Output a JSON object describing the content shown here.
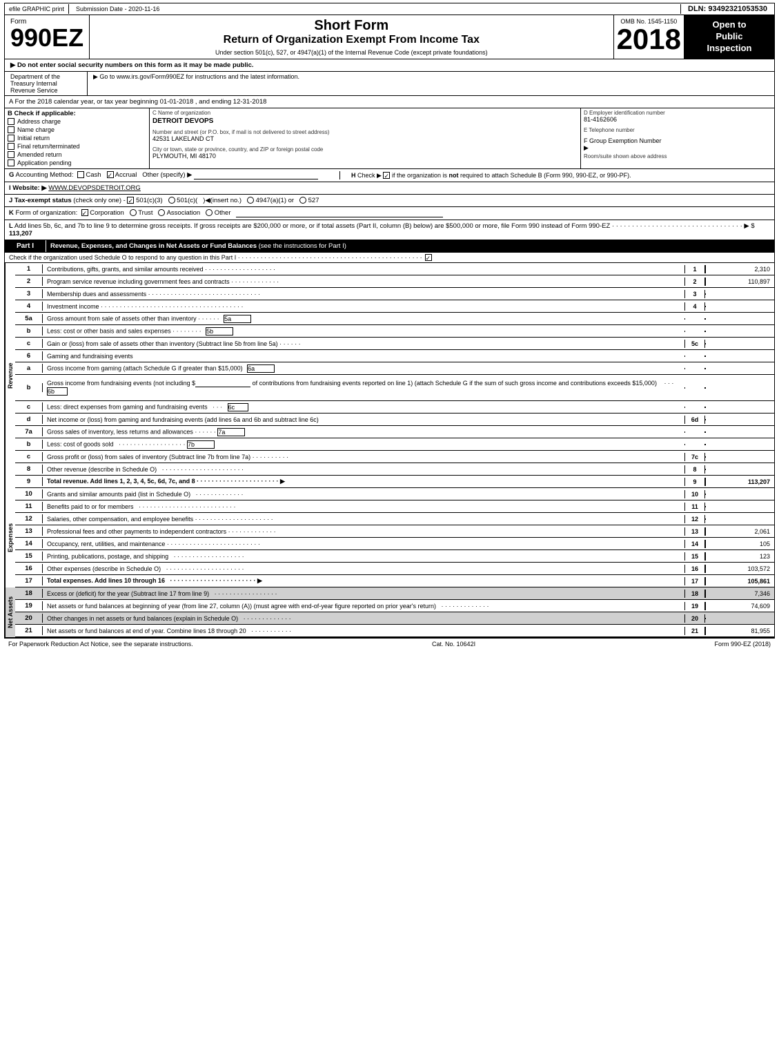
{
  "header": {
    "efile_label": "efile GRAPHIC print",
    "submission_label": "Submission Date - 2020-11-16",
    "dln": "DLN: 93492321053530",
    "form_word": "Form",
    "form_number": "990EZ",
    "short_form": "Short Form",
    "return_title": "Return of Organization Exempt From Income Tax",
    "subtitle": "Under section 501(c), 527, or 4947(a)(1) of the Internal Revenue Code (except private foundations)",
    "year": "2018",
    "omb": "OMB No. 1545-1150",
    "open_to_public": "Open to\nPublic\nInspection",
    "notice1": "▶ Do not enter social security numbers on this form as it may be made public.",
    "notice2": "▶ Go to www.irs.gov/Form990EZ for instructions and the latest information."
  },
  "dept": {
    "name": "Department of the Treasury Internal Revenue Service"
  },
  "section_a": {
    "text": "A For the 2018 calendar year, or tax year beginning 01-01-2018 , and ending 12-31-2018"
  },
  "section_b": {
    "label": "B",
    "check_label": "Check if applicable:",
    "checks": [
      {
        "label": "Address change",
        "checked": false
      },
      {
        "label": "Name change",
        "checked": false
      },
      {
        "label": "Initial return",
        "checked": false
      },
      {
        "label": "Final return/terminated",
        "checked": false
      },
      {
        "label": "Amended return",
        "checked": false
      },
      {
        "label": "Application pending",
        "checked": false
      }
    ],
    "c_label": "C Name of organization",
    "org_name": "DETROIT DEVOPS",
    "d_label": "D Employer identification number",
    "ein": "81-4162606",
    "address_label": "Number and street (or P.O. box, if mail is not delivered to street address)",
    "address": "42531 LAKELAND CT",
    "room_label": "Room/suite",
    "room": "",
    "phone_label": "E Telephone number",
    "phone": "",
    "city_label": "City or town, state or province, country, and ZIP or foreign postal code",
    "city": "PLYMOUTH, MI 48170",
    "group_label": "F Group Exemption Number",
    "group": "▶"
  },
  "section_g": {
    "label": "G Accounting Method:",
    "cash": "Cash",
    "accrual": "Accrual",
    "other": "Other (specify) ▶",
    "accrual_checked": true
  },
  "section_h": {
    "label": "H Check ▶",
    "check_label": "☑ if the organization is not required to attach Schedule B (Form 990, 990-EZ, or 990-PF)."
  },
  "section_i": {
    "label": "I Website: ▶",
    "url": "WWW.DEVOPSDETROIT.ORG"
  },
  "section_j": {
    "label": "J Tax-exempt status",
    "text": "(check only one) - ☑ 501(c)(3)  ○ 501(c)(   )◀(insert no.)  ○ 4947(a)(1) or  ○ 527"
  },
  "section_k": {
    "label": "K Form of organization:",
    "corporation": "☑ Corporation",
    "trust": "○ Trust",
    "association": "○ Association",
    "other": "○ Other"
  },
  "section_l": {
    "text": "L Add lines 5b, 6c, and 7b to line 9 to determine gross receipts. If gross receipts are $200,000 or more, or if total assets (Part II, column (B) below) are $500,000 or more, file Form 990 instead of Form 990-EZ",
    "dots": "· · · · · · · · · · · · · · · · · · · · · · · · · · · · · · · · ·",
    "arrow": "▶$",
    "value": "113,207"
  },
  "part1": {
    "label": "Part I",
    "title": "Revenue, Expenses, and Changes in Net Assets or Fund Balances",
    "title_note": "(see the instructions for Part I)",
    "check_schedule": "Check if the organization used Schedule O to respond to any question in this Part I",
    "rows": [
      {
        "num": "1",
        "desc": "Contributions, gifts, grants, and similar amounts received · · · · · · · · · · · · · · · · · · ·",
        "line": "1",
        "value": "2,310"
      },
      {
        "num": "2",
        "desc": "Program service revenue including government fees and contracts · · · · · · · · · · · · ·",
        "line": "2",
        "value": "110,897"
      },
      {
        "num": "3",
        "desc": "Membership dues and assessments · · · · · · · · · · · · · · · · · · · · · · · · · · · · · ·",
        "line": "3",
        "value": ""
      },
      {
        "num": "4",
        "desc": "Investment income · · · · · · · · · · · · · · · · · · · · · · · · · · · · · · · · · · · · · ·",
        "line": "4",
        "value": ""
      },
      {
        "num": "5a",
        "desc": "Gross amount from sale of assets other than inventory · · · · · ·",
        "subnum": "5a",
        "value": "",
        "inline": true
      },
      {
        "num": "5b",
        "desc": "Less: cost or other basis and sales expenses · · · · · · · ·",
        "subnum": "5b",
        "value": "",
        "inline": true
      },
      {
        "num": "5c",
        "desc": "Gain or (loss) from sale of assets other than inventory (Subtract line 5b from line 5a) · · · · · ·",
        "line": "5c",
        "value": ""
      },
      {
        "num": "6",
        "desc": "Gaming and fundraising events",
        "line": "",
        "value": ""
      }
    ],
    "row6a": "Gross income from gaming (attach Schedule G if greater than $15,000)  6a",
    "row6b_desc": "Gross income from fundraising events (not including $",
    "row6b_mid": "of contributions from fundraising events reported on line 1) (attach Schedule G if the sum of such gross income and contributions exceeds $15,000)",
    "row6b_num": "6b",
    "row6c": "Less: direct expenses from gaming and fundraising events",
    "row6c_num": "6c",
    "row6d": "Net income or (loss) from gaming and fundraising events (add lines 6a and 6b and subtract line 6c)",
    "row6d_num": "6d",
    "row7a": "Gross sales of inventory, less returns and allowances · · · · · ·",
    "row7a_num": "7a",
    "row7b": "Less: cost of goods sold",
    "row7b_dots": "· · · · · · · · · · · · · · · · · ·",
    "row7b_num": "7b",
    "row7c": "Gross profit or (loss) from sales of inventory (Subtract line 7b from line 7a) · · · · · · · · · ·",
    "row7c_num": "7c",
    "row8": "Other revenue (describe in Schedule O)",
    "row8_dots": "· · · · · · · · · · · · · · · · · · · · · ·",
    "row8_num": "8",
    "row9_desc": "Total revenue. Add lines 1, 2, 3, 4, 5c, 6d, 7c, and 8 · · · · · · · · · · · · · · · · · · · · · ·",
    "row9_num": "9",
    "row9_value": "113,207",
    "expenses_rows": [
      {
        "num": "10",
        "desc": "Grants and similar amounts paid (list in Schedule O)",
        "dots": "· · · · · · · · · · · · · ·",
        "line": "10",
        "value": ""
      },
      {
        "num": "11",
        "desc": "Benefits paid to or for members",
        "dots": "· · · · · · · · · · · · · · · · · · · · · · · · · ·",
        "line": "11",
        "value": ""
      },
      {
        "num": "12",
        "desc": "Salaries, other compensation, and employee benefits · · · · · · · · · · · · · · · · · · · · ·",
        "line": "12",
        "value": ""
      },
      {
        "num": "13",
        "desc": "Professional fees and other payments to independent contractors · · · · · · · · · · · · ·",
        "line": "13",
        "value": "2,061"
      },
      {
        "num": "14",
        "desc": "Occupancy, rent, utilities, and maintenance · · · · · · · · · · · · · · · · · · · · · · · · ·",
        "line": "14",
        "value": "105"
      },
      {
        "num": "15",
        "desc": "Printing, publications, postage, and shipping",
        "dots": "· · · · · · · · · · · · · · · · · · ·",
        "line": "15",
        "value": "123"
      },
      {
        "num": "16",
        "desc": "Other expenses (describe in Schedule O)",
        "dots": "· · · · · · · · · · · · · · · · · · · · ·",
        "line": "16",
        "value": "103,572"
      }
    ],
    "row17_desc": "Total expenses. Add lines 10 through 16",
    "row17_dots": "· · · · · · · · · · · · · · · · · · · · · · ·",
    "row17_num": "17",
    "row17_value": "105,861",
    "row18_desc": "Excess or (deficit) for the year (Subtract line 17 from line 9)",
    "row18_dots": "· · · · · · · · · · · · · · · · ·",
    "row18_num": "18",
    "row18_value": "7,346",
    "row19_desc": "Net assets or fund balances at beginning of year (from line 27, column (A)) (must agree with end-of-year figure reported on prior year's return)",
    "row19_dots": "· · · · · · · · · · · · · ·",
    "row19_num": "19",
    "row19_value": "74,609",
    "row20_desc": "Other changes in net assets or fund balances (explain in Schedule O)",
    "row20_dots": "· · · · · · · · · · · · · ·",
    "row20_num": "20",
    "row20_value": "",
    "row21_desc": "Net assets or fund balances at end of year. Combine lines 18 through 20",
    "row21_dots": "· · · · · · · · · · · ·",
    "row21_num": "21",
    "row21_value": "81,955"
  },
  "footer": {
    "left": "For Paperwork Reduction Act Notice, see the separate instructions.",
    "cat": "Cat. No. 10642I",
    "right": "Form 990-EZ (2018)"
  }
}
